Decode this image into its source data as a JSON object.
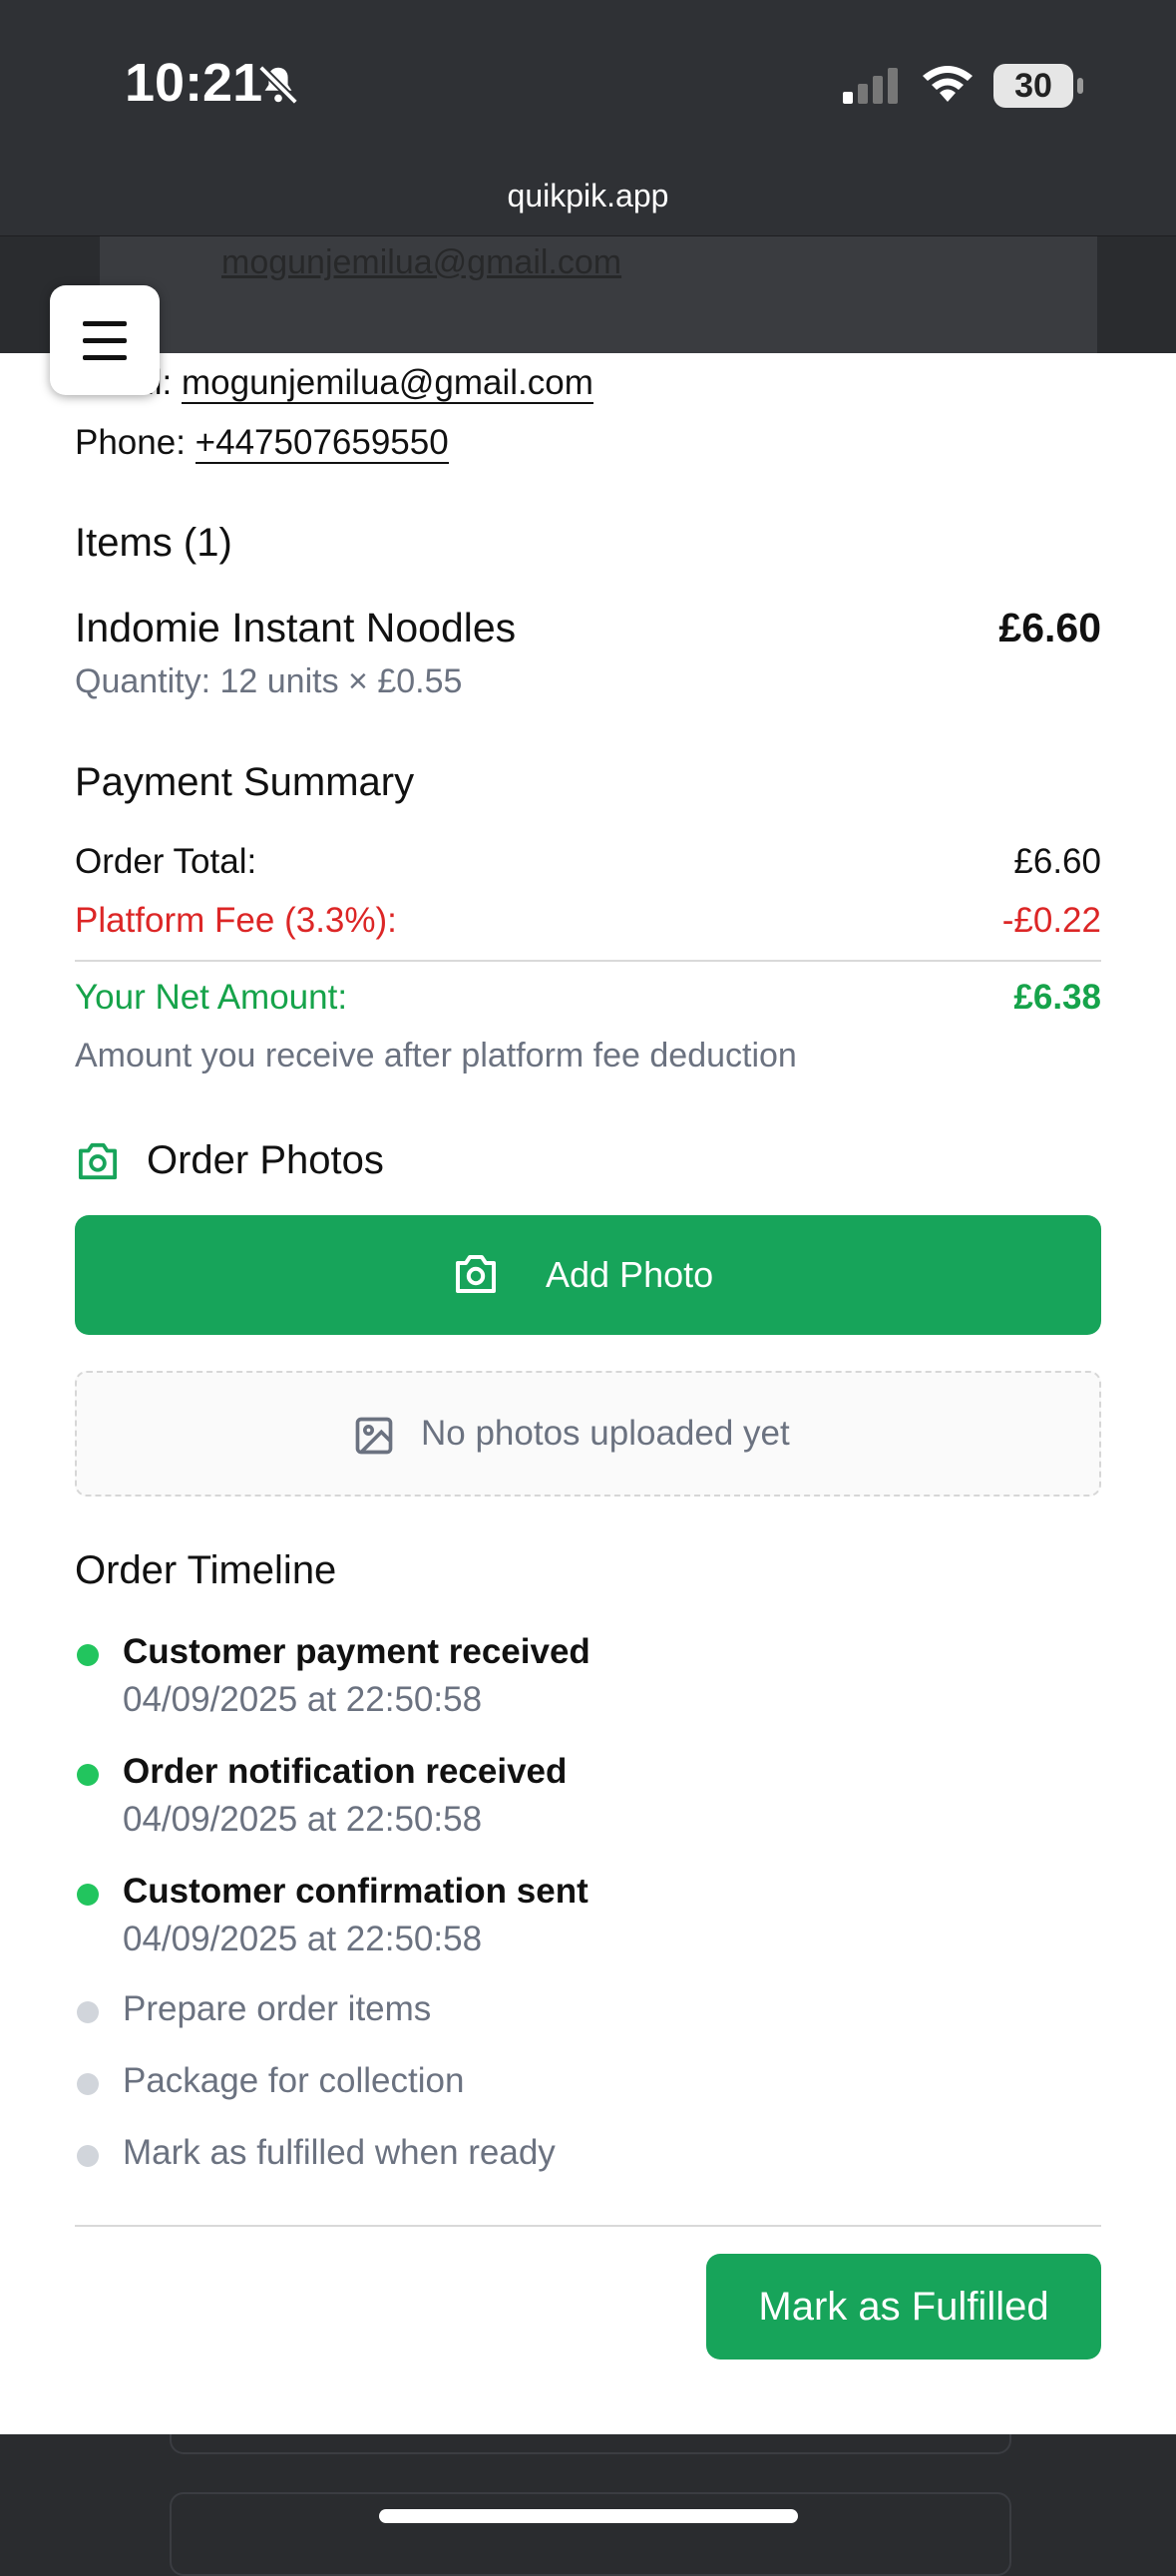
{
  "status_bar": {
    "time": "10:21",
    "battery": "30",
    "icons": [
      "bell-slash-icon",
      "cellular-signal-icon",
      "wifi-icon",
      "battery-icon"
    ]
  },
  "browser": {
    "url": "quikpik.app"
  },
  "background": {
    "email": "mogunjemilua@gmail.com"
  },
  "menu": {
    "icon": "hamburger-menu-icon"
  },
  "contact": {
    "email_label": "Email:",
    "email_value": "mogunjemilua@gmail.com",
    "phone_label": "Phone:",
    "phone_value": "+447507659550"
  },
  "items": {
    "heading": "Items (1)",
    "list": [
      {
        "name": "Indomie Instant Noodles",
        "price": "£6.60",
        "quantity": "Quantity: 12 units × £0.55"
      }
    ]
  },
  "payment": {
    "heading": "Payment Summary",
    "order_total_label": "Order Total:",
    "order_total_value": "£6.60",
    "fee_label": "Platform Fee (3.3%):",
    "fee_value": "-£0.22",
    "net_label": "Your Net Amount:",
    "net_value": "£6.38",
    "note": "Amount you receive after platform fee deduction"
  },
  "photos": {
    "heading": "Order Photos",
    "add_label": "Add Photo",
    "empty_text": "No photos uploaded yet"
  },
  "timeline": {
    "heading": "Order Timeline",
    "steps": [
      {
        "title": "Customer payment received",
        "time": "04/09/2025 at 22:50:58",
        "done": true
      },
      {
        "title": "Order notification received",
        "time": "04/09/2025 at 22:50:58",
        "done": true
      },
      {
        "title": "Customer confirmation sent",
        "time": "04/09/2025 at 22:50:58",
        "done": true
      },
      {
        "title": "Prepare order items",
        "done": false
      },
      {
        "title": "Package for collection",
        "done": false
      },
      {
        "title": "Mark as fulfilled when ready",
        "done": false
      }
    ]
  },
  "actions": {
    "fulfill_label": "Mark as Fulfilled"
  },
  "colors": {
    "accent_green": "#17a45a",
    "done_dot": "#22c55e",
    "fee_red": "#dc2626",
    "muted": "#6b7280"
  }
}
